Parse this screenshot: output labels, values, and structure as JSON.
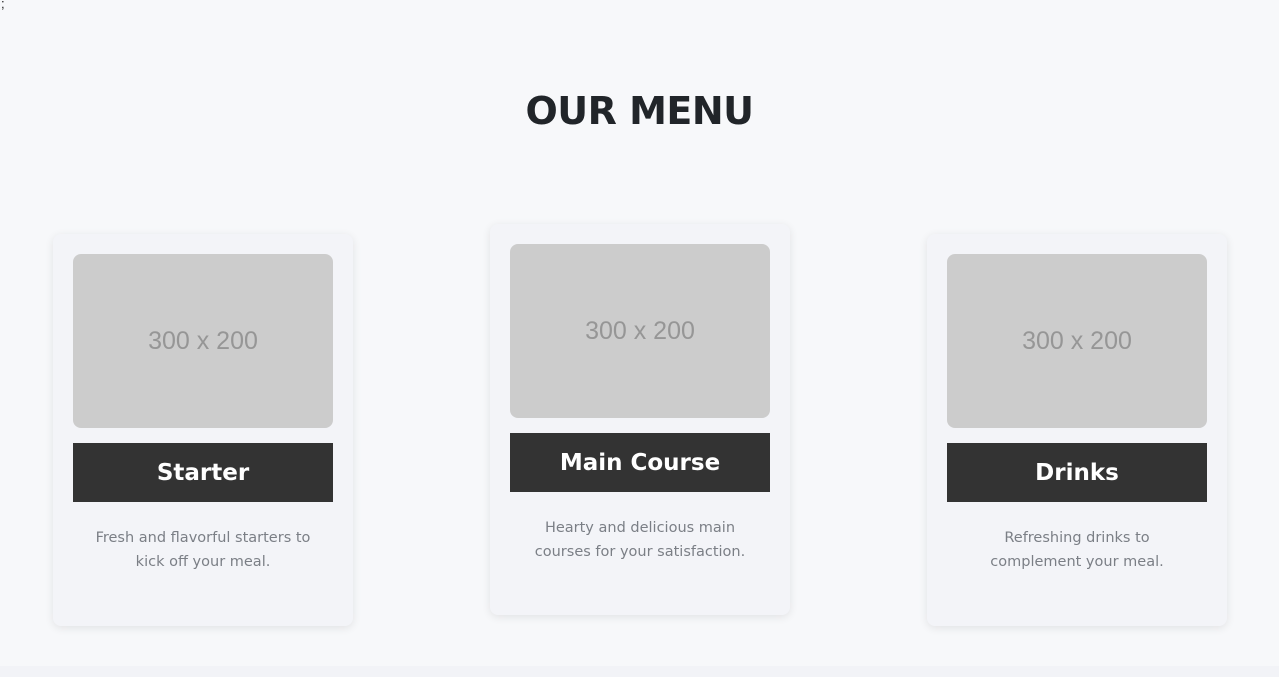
{
  "page": {
    "stray_text": ";",
    "title": "OUR MENU"
  },
  "menu": {
    "items": [
      {
        "image_placeholder": "300 x 200",
        "label": "Starter",
        "description": "Fresh and flavorful starters to kick off your meal."
      },
      {
        "image_placeholder": "300 x 200",
        "label": "Main Course",
        "description": "Hearty and delicious main courses for your satisfaction."
      },
      {
        "image_placeholder": "300 x 200",
        "label": "Drinks",
        "description": "Refreshing drinks to complement your meal."
      }
    ]
  },
  "colors": {
    "background": "#f7f8fa",
    "card_background": "#f3f4f8",
    "image_placeholder": "#cccccc",
    "label_background": "#333333",
    "title_text": "#212529",
    "description_text": "#7b7f86"
  }
}
